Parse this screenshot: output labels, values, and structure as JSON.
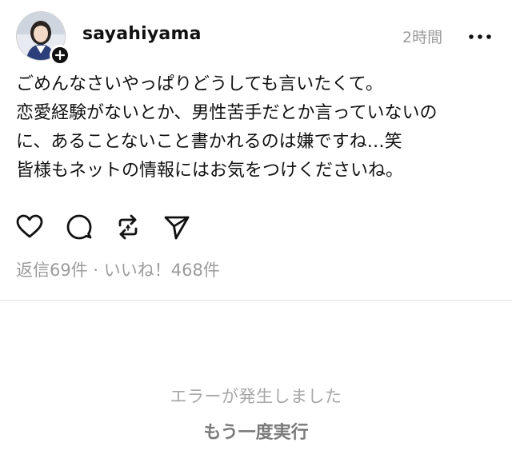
{
  "post": {
    "username": "sayahiyama",
    "timestamp": "2時間",
    "body_lines": [
      "ごめんなさいやっぱりどうしても言いたくて。",
      "恋愛経験がないとか、男性苦手だとか言っていないの",
      "に、あることないこと書かれるのは嫌ですね…笑",
      "皆様もネットの情報にはお気をつけくださいね。"
    ],
    "stats": "返信69件 · いいね！468件",
    "icons": {
      "more": "more-icon",
      "like": "heart-icon",
      "reply": "comment-icon",
      "repost": "repost-icon",
      "share": "send-icon",
      "follow": "plus-icon"
    }
  },
  "error": {
    "message": "エラーが発生しました",
    "retry_label": "もう一度実行"
  }
}
